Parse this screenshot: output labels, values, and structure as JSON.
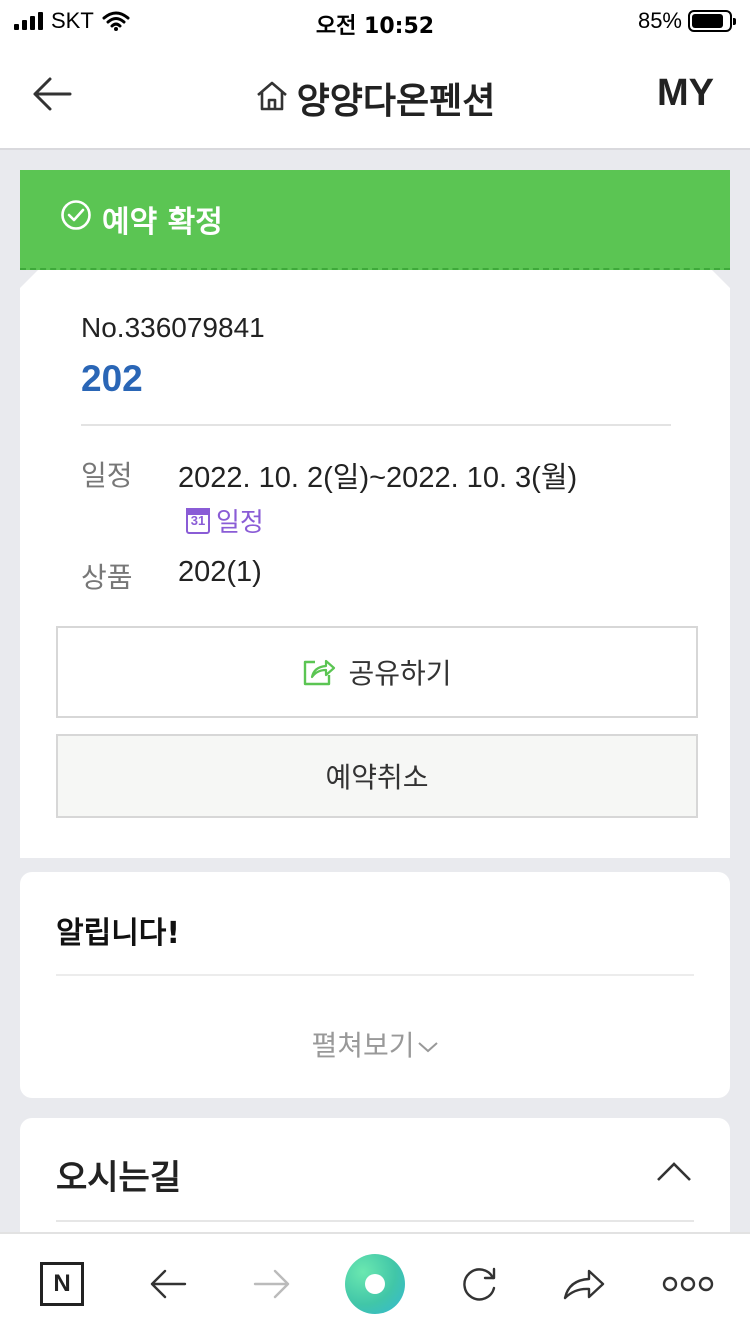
{
  "status_bar": {
    "carrier": "SKT",
    "time": "오전 10:52",
    "battery_percent": "85%",
    "battery_level": 0.85
  },
  "header": {
    "title": "양양다온펜션",
    "my_label": "MY"
  },
  "reservation": {
    "status": "예약 확정",
    "number": "No.336079841",
    "room": "202",
    "schedule_label": "일정",
    "schedule_value": "2022. 10. 2(일)~2022. 10. 3(월)",
    "calendar_link": "일정",
    "calendar_icon_day": "31",
    "product_label": "상품",
    "product_value": "202(1)",
    "share_button": "공유하기",
    "cancel_button": "예약취소"
  },
  "notice": {
    "title": "알립니다!",
    "expand_label": "펼쳐보기"
  },
  "directions": {
    "title": "오시는길"
  },
  "toolbar": {
    "naver_label": "N"
  },
  "colors": {
    "accent_green": "#5bc553",
    "room_blue": "#2a66b6",
    "calendar_purple": "#8a5cd6"
  }
}
